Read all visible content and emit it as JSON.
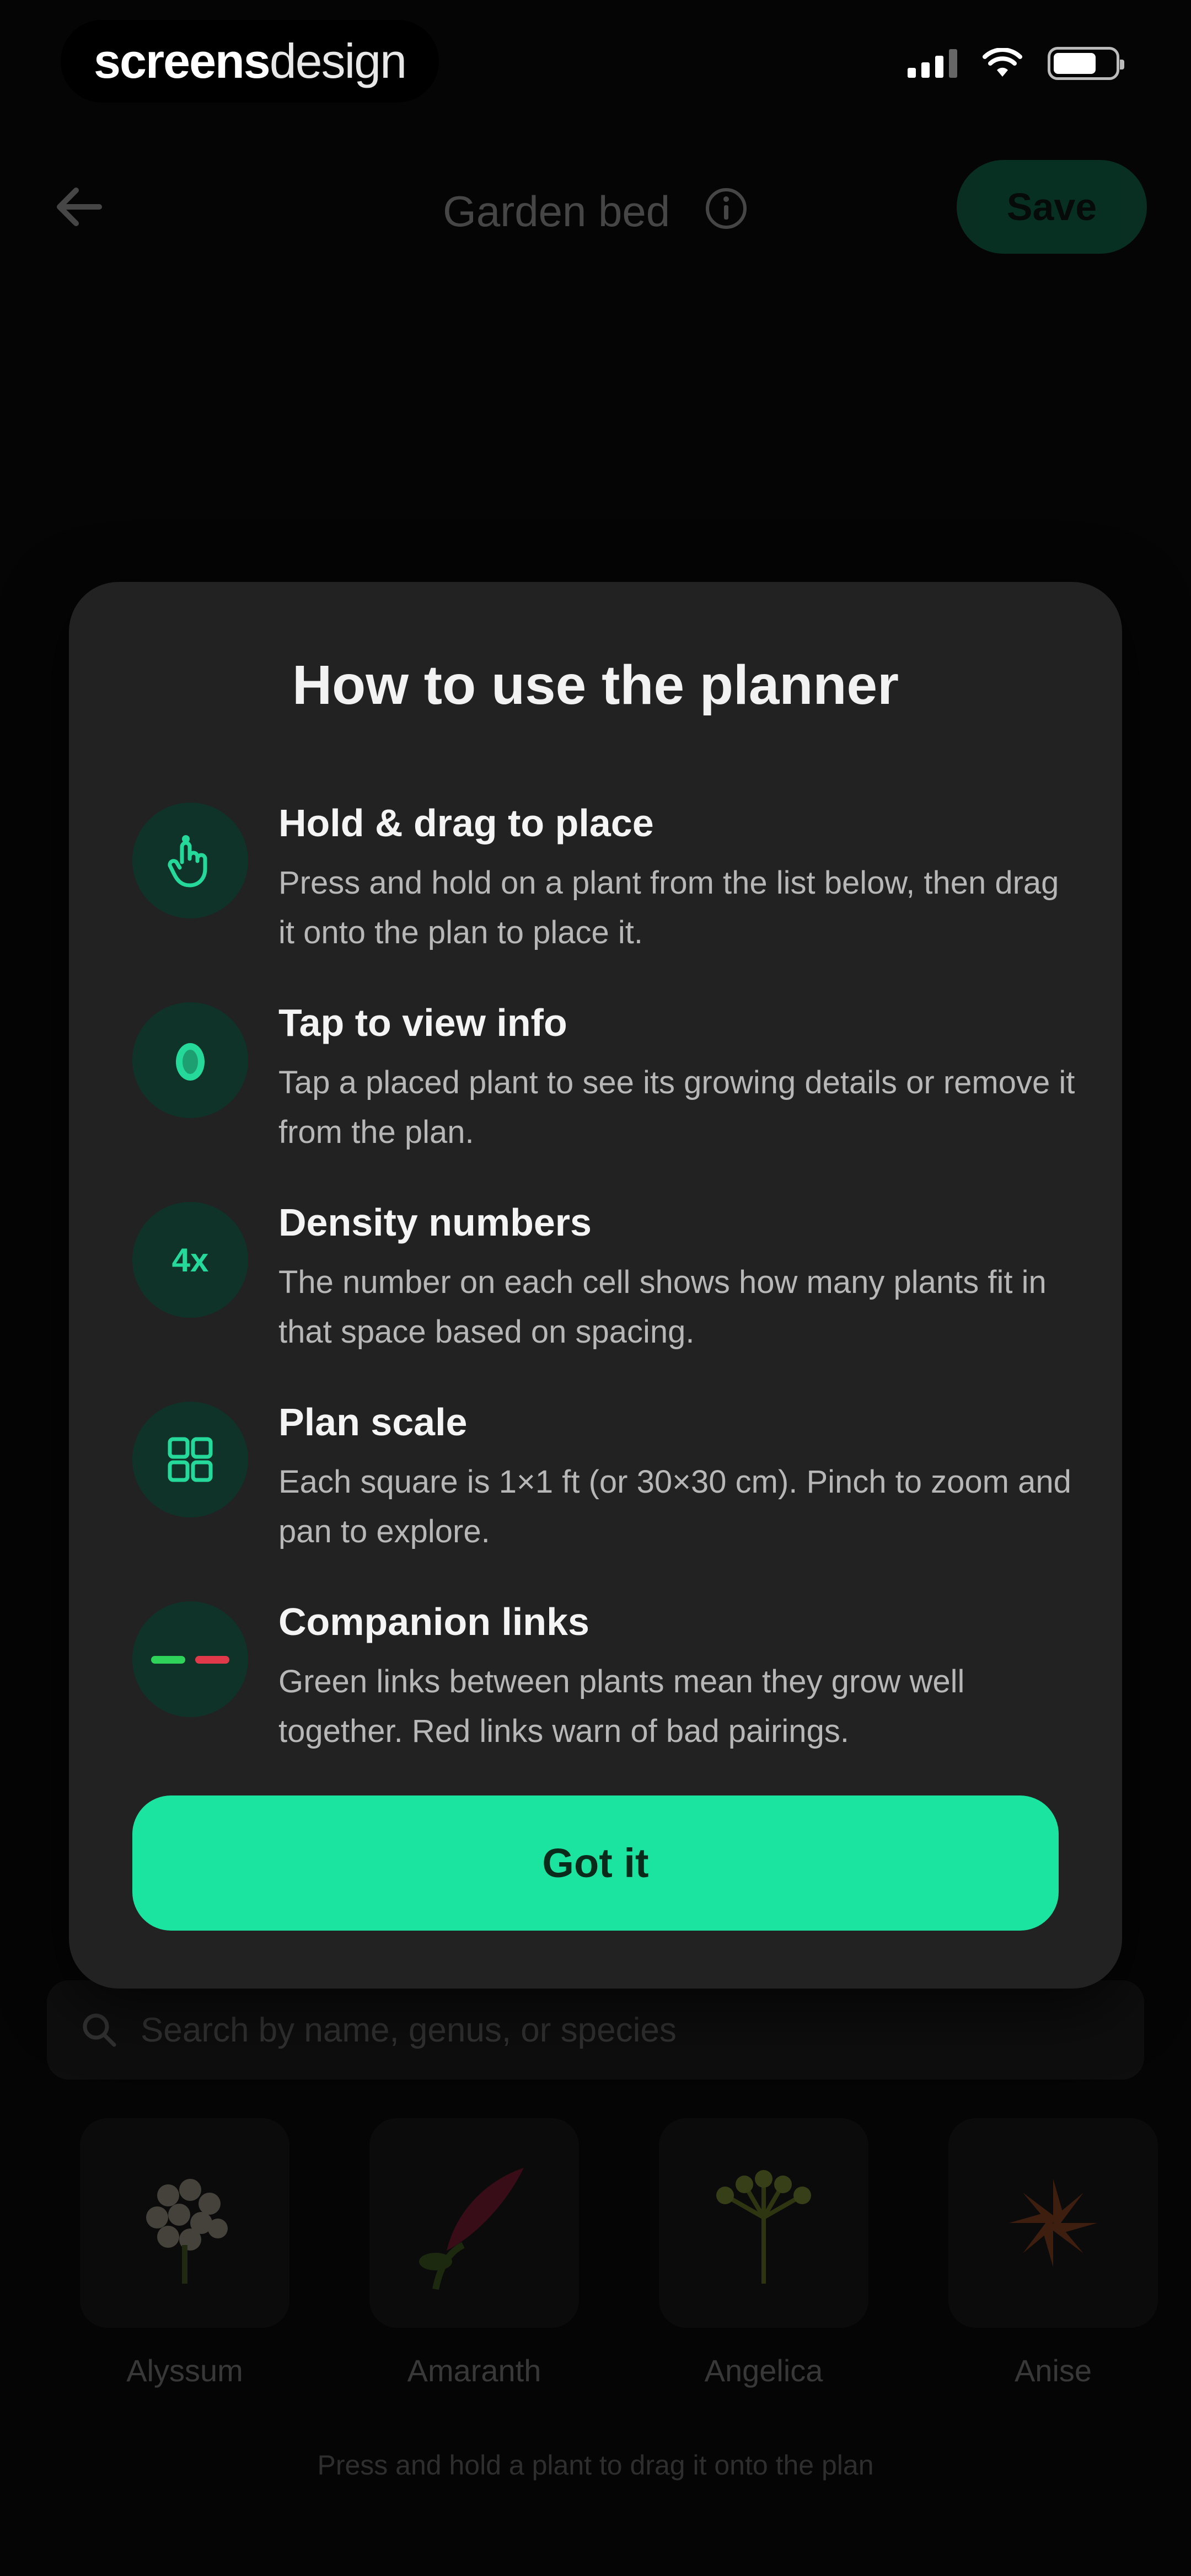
{
  "status_bar": {
    "brand_bold": "screens",
    "brand_light": "design"
  },
  "nav": {
    "title": "Garden bed",
    "save_label": "Save"
  },
  "modal": {
    "title": "How to use the planner",
    "tips": [
      {
        "icon": "hand-drag-icon",
        "heading": "Hold & drag to place",
        "body": "Press and hold on a plant from the list below, then drag it onto the plan to place it."
      },
      {
        "icon": "tap-icon",
        "heading": "Tap to view info",
        "body": "Tap a placed plant to see its growing details or remove it from the plan."
      },
      {
        "icon": "density-icon",
        "badge": "4x",
        "heading": "Density numbers",
        "body": "The number on each cell shows how many plants fit in that space based on spacing."
      },
      {
        "icon": "grid-icon",
        "heading": "Plan scale",
        "body": "Each square is 1×1 ft (or 30×30 cm). Pinch to zoom and pan to explore."
      },
      {
        "icon": "companion-links-icon",
        "heading": "Companion links",
        "body": "Green links between plants mean they grow well together. Red links warn of bad pairings."
      }
    ],
    "confirm_label": "Got it"
  },
  "background": {
    "search_placeholder": "Search by name, genus, or species",
    "plants": [
      "Alyssum",
      "Amaranth",
      "Angelica",
      "Anise"
    ],
    "hint": "Press and hold a plant to drag it onto the plan"
  },
  "colors": {
    "accent": "#1be3a0",
    "icon_bg": "#0f3328",
    "card_bg": "#222222",
    "good_link": "#2fd35a",
    "bad_link": "#e0394a"
  }
}
